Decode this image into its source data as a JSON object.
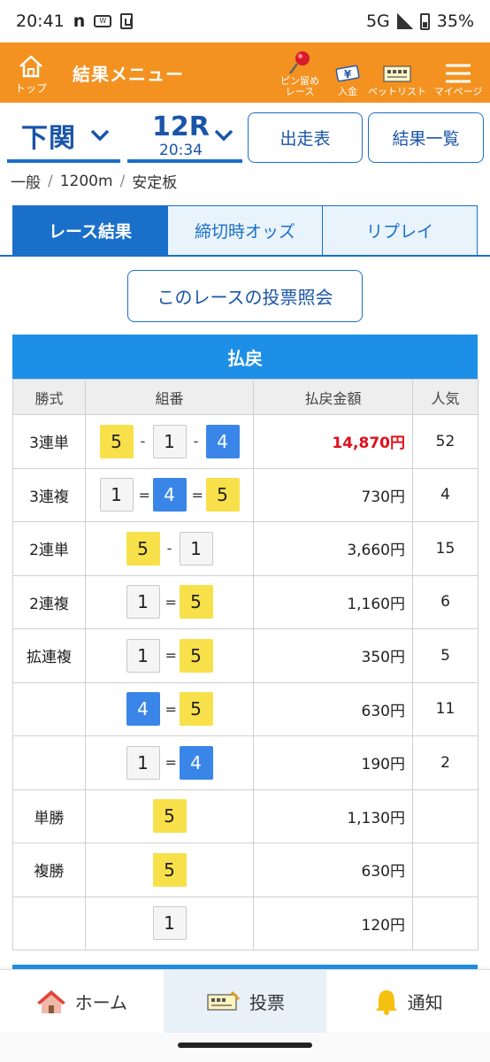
{
  "status_bar": {
    "time": "20:41",
    "network": "5G",
    "battery": "35%"
  },
  "header": {
    "top_label": "トップ",
    "title": "結果メニュー",
    "items": [
      {
        "label1": "ピン留め",
        "label2": "レース"
      },
      {
        "label1": "入金",
        "label2": ""
      },
      {
        "label1": "ベットリスト",
        "label2": ""
      },
      {
        "label1": "マイページ",
        "label2": ""
      }
    ]
  },
  "selector": {
    "venue": "下関",
    "race_number": "12R",
    "race_time": "20:34",
    "entry_button": "出走表",
    "results_button": "結果一覧"
  },
  "race_info": {
    "grade": "一般",
    "distance": "1200m",
    "board": "安定板"
  },
  "tabs": [
    {
      "label": "レース結果",
      "active": true
    },
    {
      "label": "締切時オッズ",
      "active": false
    },
    {
      "label": "リプレイ",
      "active": false
    }
  ],
  "inquiry_button": "このレースの投票照会",
  "payout": {
    "title": "払戻",
    "headers": [
      "勝式",
      "組番",
      "払戻金額",
      "人気"
    ],
    "rows": [
      {
        "kind": "3連単",
        "boats": [
          "5",
          "1",
          "4"
        ],
        "sep": "-",
        "amount": "14,870円",
        "pop": "52"
      },
      {
        "kind": "3連複",
        "boats": [
          "1",
          "4",
          "5"
        ],
        "sep": "=",
        "amount": "730円",
        "pop": "4"
      },
      {
        "kind": "2連単",
        "boats": [
          "5",
          "1"
        ],
        "sep": "-",
        "amount": "3,660円",
        "pop": "15"
      },
      {
        "kind": "2連複",
        "boats": [
          "1",
          "5"
        ],
        "sep": "=",
        "amount": "1,160円",
        "pop": "6"
      },
      {
        "kind": "拡連複",
        "boats": [
          "1",
          "5"
        ],
        "sep": "=",
        "amount": "350円",
        "pop": "5"
      },
      {
        "kind": "",
        "boats": [
          "4",
          "5"
        ],
        "sep": "=",
        "amount": "630円",
        "pop": "11"
      },
      {
        "kind": "",
        "boats": [
          "1",
          "4"
        ],
        "sep": "=",
        "amount": "190円",
        "pop": "2"
      },
      {
        "kind": "単勝",
        "boats": [
          "5"
        ],
        "sep": "",
        "amount": "1,130円",
        "pop": ""
      },
      {
        "kind": "複勝",
        "boats": [
          "5"
        ],
        "sep": "",
        "amount": "630円",
        "pop": ""
      },
      {
        "kind": "",
        "boats": [
          "1"
        ],
        "sep": "",
        "amount": "120円",
        "pop": ""
      }
    ]
  },
  "bottom_nav": [
    {
      "label": "ホーム",
      "icon": "house-icon"
    },
    {
      "label": "投票",
      "icon": "ticket-icon"
    },
    {
      "label": "通知",
      "icon": "bell-icon"
    }
  ],
  "colors": {
    "header_orange": "#f39221",
    "primary_blue": "#1a6fc9",
    "boat1": "#f5f5f5",
    "boat4": "#3a86e8",
    "boat5": "#f8e04a",
    "highlight_red": "#e0101a"
  }
}
